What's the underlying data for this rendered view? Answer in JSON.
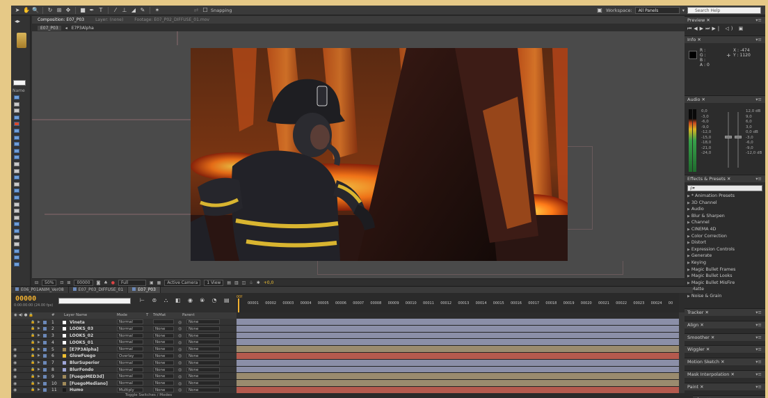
{
  "toolbar": {
    "snapping_label": "Snapping",
    "workspace_label": "Workspace:",
    "workspace_value": "All Panels",
    "search_placeholder": "Search Help"
  },
  "comp_panel": {
    "tab_composition": "Composition: E07_P03",
    "tab_layer": "Layer: (none)",
    "tab_footage": "Footage: E07_P02_DIFFUSE_01.mov",
    "breadcrumb_1": "E07_P03",
    "breadcrumb_2": "E7P3Alpha",
    "zoom": "50%",
    "timecode": "00000",
    "resolution": "Full",
    "camera": "Active Camera",
    "views": "1 View",
    "exposure": "+0,0"
  },
  "project": {
    "name_header": "Name"
  },
  "right_panels": {
    "preview_title": "Preview",
    "info_title": "Info",
    "info_r": "R :",
    "info_g": "G :",
    "info_b": "B :",
    "info_a": "A : 0",
    "info_x": "X : -474",
    "info_y": "Y : 1120",
    "audio_title": "Audio",
    "audio_left_labels": [
      "0,0",
      "-3,0",
      "-6,0",
      "-9,0",
      "-12,0",
      "-15,0",
      "-18,0",
      "-21,0",
      "-24,0"
    ],
    "audio_right_labels": [
      "12,0 dB",
      "9,0",
      "6,0",
      "3,0",
      "0,0 dB",
      "-3,0",
      "-6,0",
      "-9,0",
      "-12,0 dB"
    ],
    "effects_title": "Effects & Presets",
    "effects_search": "ρ▾",
    "effects": [
      "* Animation Presets",
      "3D Channel",
      "Audio",
      "Blur & Sharpen",
      "Channel",
      "CINEMA 4D",
      "Color Correction",
      "Distort",
      "Expression Controls",
      "Generate",
      "Keying",
      "Magic Bullet Frames",
      "Magic Bullet Looks",
      "Magic Bullet MisFire",
      "Matte",
      "Noise & Grain"
    ],
    "panels": [
      "Tracker",
      "Align",
      "Smoother",
      "Wiggler",
      "Motion Sketch",
      "Mask Interpolation",
      "Paint",
      "Brushes"
    ]
  },
  "timeline": {
    "tabs": [
      "E06_P01ANIM_Ver08",
      "E07_P03_DIFFUSE_01",
      "E07_P03"
    ],
    "timecode": "00000",
    "timecode_sub": "0:00:00:00 (24.00 fps)",
    "ruler_start": "00f",
    "ruler_ticks": [
      "00001",
      "00002",
      "00003",
      "00004",
      "00005",
      "00006",
      "00007",
      "00008",
      "00009",
      "00010",
      "00011",
      "00012",
      "00013",
      "00014",
      "00015",
      "00016",
      "00017",
      "00018",
      "00019",
      "00020",
      "00021",
      "00022",
      "00023",
      "00024",
      "00"
    ],
    "col_headers": {
      "num": "#",
      "layer_name": "Layer Name",
      "mode": "Mode",
      "t": "T",
      "trkmat": "TrkMat",
      "parent": "Parent"
    },
    "layers": [
      {
        "num": "1",
        "name": "Vineta",
        "mode": "Normal",
        "trkmat": "",
        "parent": "None",
        "label": "#ffffff",
        "track": "#8b8fa8"
      },
      {
        "num": "2",
        "name": "LOOKS_03",
        "mode": "Normal",
        "trkmat": "None",
        "parent": "None",
        "label": "#ffffff",
        "track": "#8b8fa8"
      },
      {
        "num": "3",
        "name": "LOOKS_02",
        "mode": "Normal",
        "trkmat": "None",
        "parent": "None",
        "label": "#ffffff",
        "track": "#8b8fa8"
      },
      {
        "num": "4",
        "name": "LOOKS_01",
        "mode": "Normal",
        "trkmat": "None",
        "parent": "None",
        "label": "#ffffff",
        "track": "#8b8fa8"
      },
      {
        "num": "5",
        "name": "[E7P3Alpha]",
        "mode": "Normal",
        "trkmat": "None",
        "parent": "None",
        "label": "#a08a5a",
        "track": "#9a8b6e"
      },
      {
        "num": "6",
        "name": "GlowFuego",
        "mode": "Overlay",
        "trkmat": "None",
        "parent": "None",
        "label": "#f0c030",
        "track": "#b45a4e"
      },
      {
        "num": "7",
        "name": "BlurSuperior",
        "mode": "Normal",
        "trkmat": "None",
        "parent": "None",
        "label": "#9fa6d8",
        "track": "#8b8fa8"
      },
      {
        "num": "8",
        "name": "BlurFondo",
        "mode": "Normal",
        "trkmat": "None",
        "parent": "None",
        "label": "#9fa6d8",
        "track": "#8b8fa8"
      },
      {
        "num": "9",
        "name": "[FuegoMED3d]",
        "mode": "Normal",
        "trkmat": "None",
        "parent": "None",
        "label": "#a08a5a",
        "track": "#9a8b6e"
      },
      {
        "num": "10",
        "name": "[FuegoMediano]",
        "mode": "Normal",
        "trkmat": "None",
        "parent": "None",
        "label": "#a08a5a",
        "track": "#9a8b6e"
      },
      {
        "num": "11",
        "name": "Humo",
        "mode": "Multiply",
        "trkmat": "None",
        "parent": "None",
        "label": "#1a1a1a",
        "track": "#b45a4e"
      }
    ],
    "toggle_label": "Toggle Switches / Modes"
  }
}
